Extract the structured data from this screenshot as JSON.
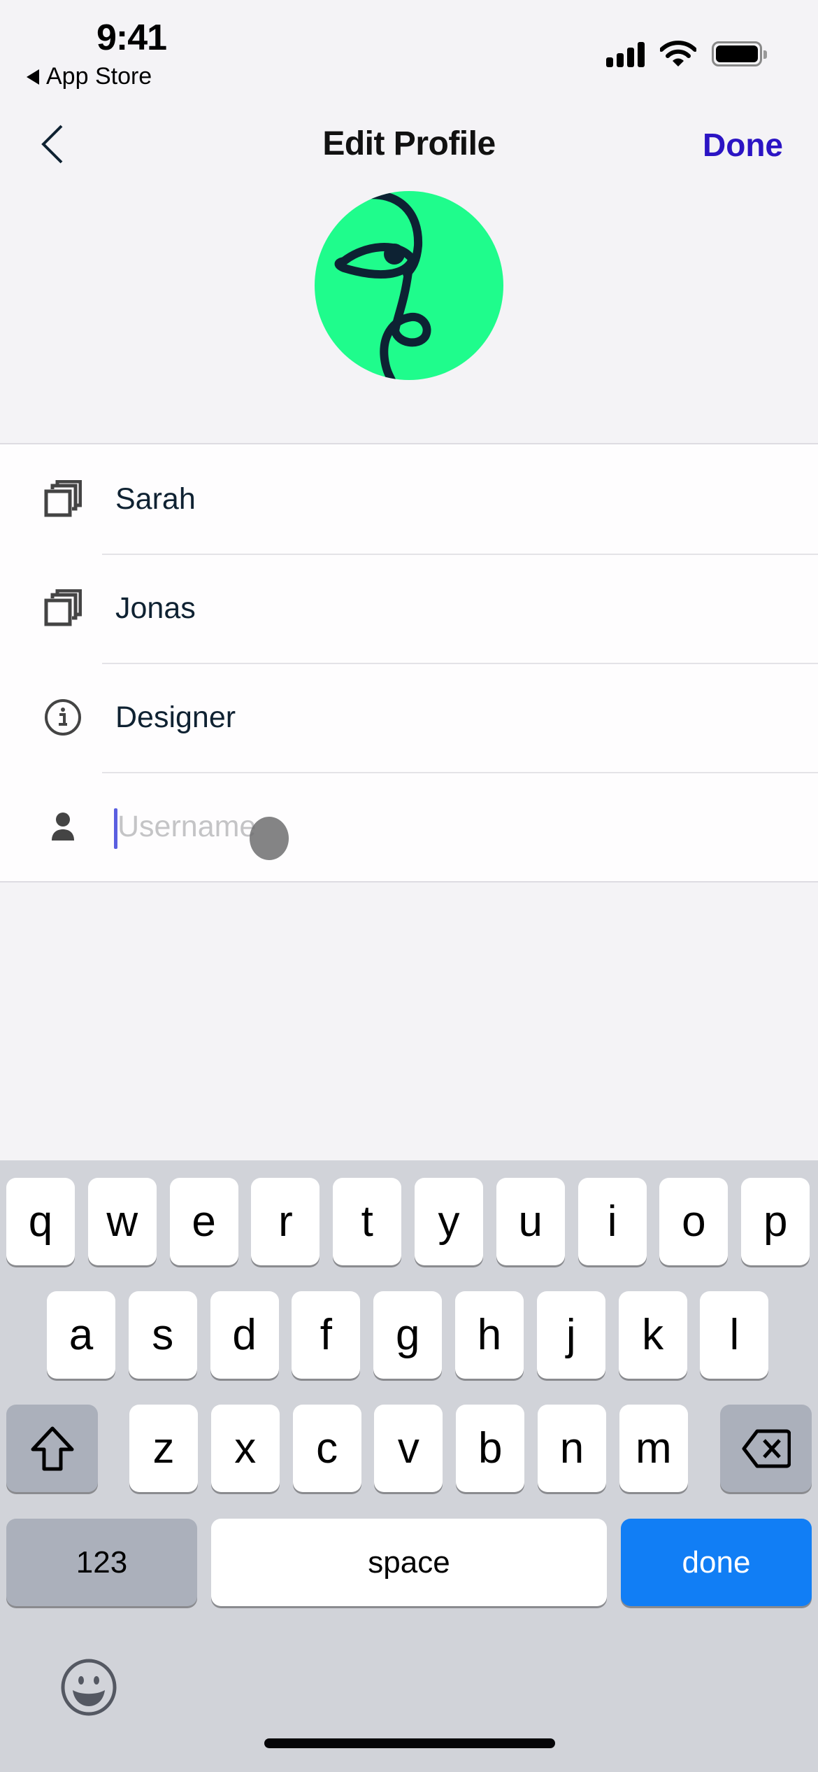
{
  "status_bar": {
    "time": "9:41",
    "back_app": "App Store",
    "icons": [
      "cellular-signal-icon",
      "wifi-icon",
      "battery-icon"
    ]
  },
  "nav": {
    "back_icon": "chevron-left-icon",
    "title": "Edit Profile",
    "done_label": "Done",
    "accent_color": "#2b14c4"
  },
  "avatar": {
    "icon": "line-art-face-icon",
    "background_color": "#1ffc8c"
  },
  "fields": [
    {
      "icon": "stacked-squares-icon",
      "value": "Sarah",
      "placeholder": ""
    },
    {
      "icon": "stacked-squares-icon",
      "value": "Jonas",
      "placeholder": ""
    },
    {
      "icon": "info-circle-icon",
      "value": "Designer",
      "placeholder": ""
    },
    {
      "icon": "person-icon",
      "value": "",
      "placeholder": "Username",
      "focused": true
    }
  ],
  "keyboard": {
    "row1": [
      "q",
      "w",
      "e",
      "r",
      "t",
      "y",
      "u",
      "i",
      "o",
      "p"
    ],
    "row2": [
      "a",
      "s",
      "d",
      "f",
      "g",
      "h",
      "j",
      "k",
      "l"
    ],
    "row3": [
      "z",
      "x",
      "c",
      "v",
      "b",
      "n",
      "m"
    ],
    "shift_icon": "shift-arrow-icon",
    "delete_icon": "delete-backspace-icon",
    "numbers_label": "123",
    "space_label": "space",
    "return_label": "done",
    "return_color": "#117ef5",
    "emoji_icon": "emoji-smiley-icon"
  }
}
